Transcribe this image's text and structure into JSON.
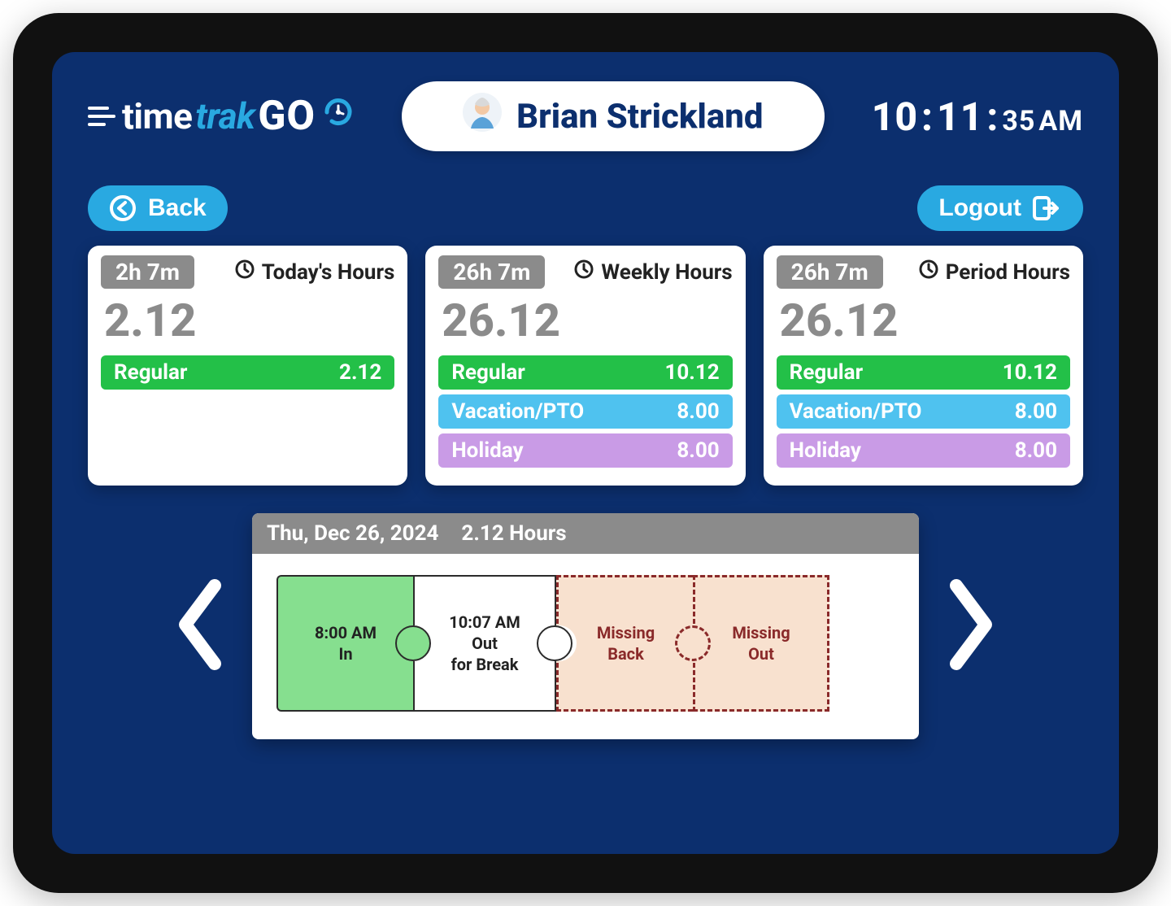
{
  "logo": {
    "time": "time",
    "trak": "trak",
    "go": "GO"
  },
  "user": {
    "name": "Brian Strickland"
  },
  "clock": {
    "hh": "10",
    "mm": "11",
    "ss": "35",
    "ampm": "AM"
  },
  "actions": {
    "back": "Back",
    "logout": "Logout"
  },
  "cards": [
    {
      "badge": "2h 7m",
      "title": "Today's Hours",
      "big": "2.12",
      "rows": [
        {
          "label": "Regular",
          "value": "2.12",
          "style": "row-green"
        }
      ]
    },
    {
      "badge": "26h 7m",
      "title": "Weekly Hours",
      "big": "26.12",
      "rows": [
        {
          "label": "Regular",
          "value": "10.12",
          "style": "row-green"
        },
        {
          "label": "Vacation/PTO",
          "value": "8.00",
          "style": "row-blue"
        },
        {
          "label": "Holiday",
          "value": "8.00",
          "style": "row-purple"
        }
      ]
    },
    {
      "badge": "26h 7m",
      "title": "Period Hours",
      "big": "26.12",
      "rows": [
        {
          "label": "Regular",
          "value": "10.12",
          "style": "row-green"
        },
        {
          "label": "Vacation/PTO",
          "value": "8.00",
          "style": "row-blue"
        },
        {
          "label": "Holiday",
          "value": "8.00",
          "style": "row-purple"
        }
      ]
    }
  ],
  "timeline": {
    "date": "Thu, Dec 26, 2024",
    "hours": "2.12 Hours",
    "pieces": [
      {
        "line1": "8:00 AM",
        "line2": "In",
        "line3": ""
      },
      {
        "line1": "10:07 AM",
        "line2": "Out",
        "line3": "for Break"
      },
      {
        "line1": "Missing",
        "line2": "Back",
        "line3": ""
      },
      {
        "line1": "Missing",
        "line2": "Out",
        "line3": ""
      }
    ]
  }
}
